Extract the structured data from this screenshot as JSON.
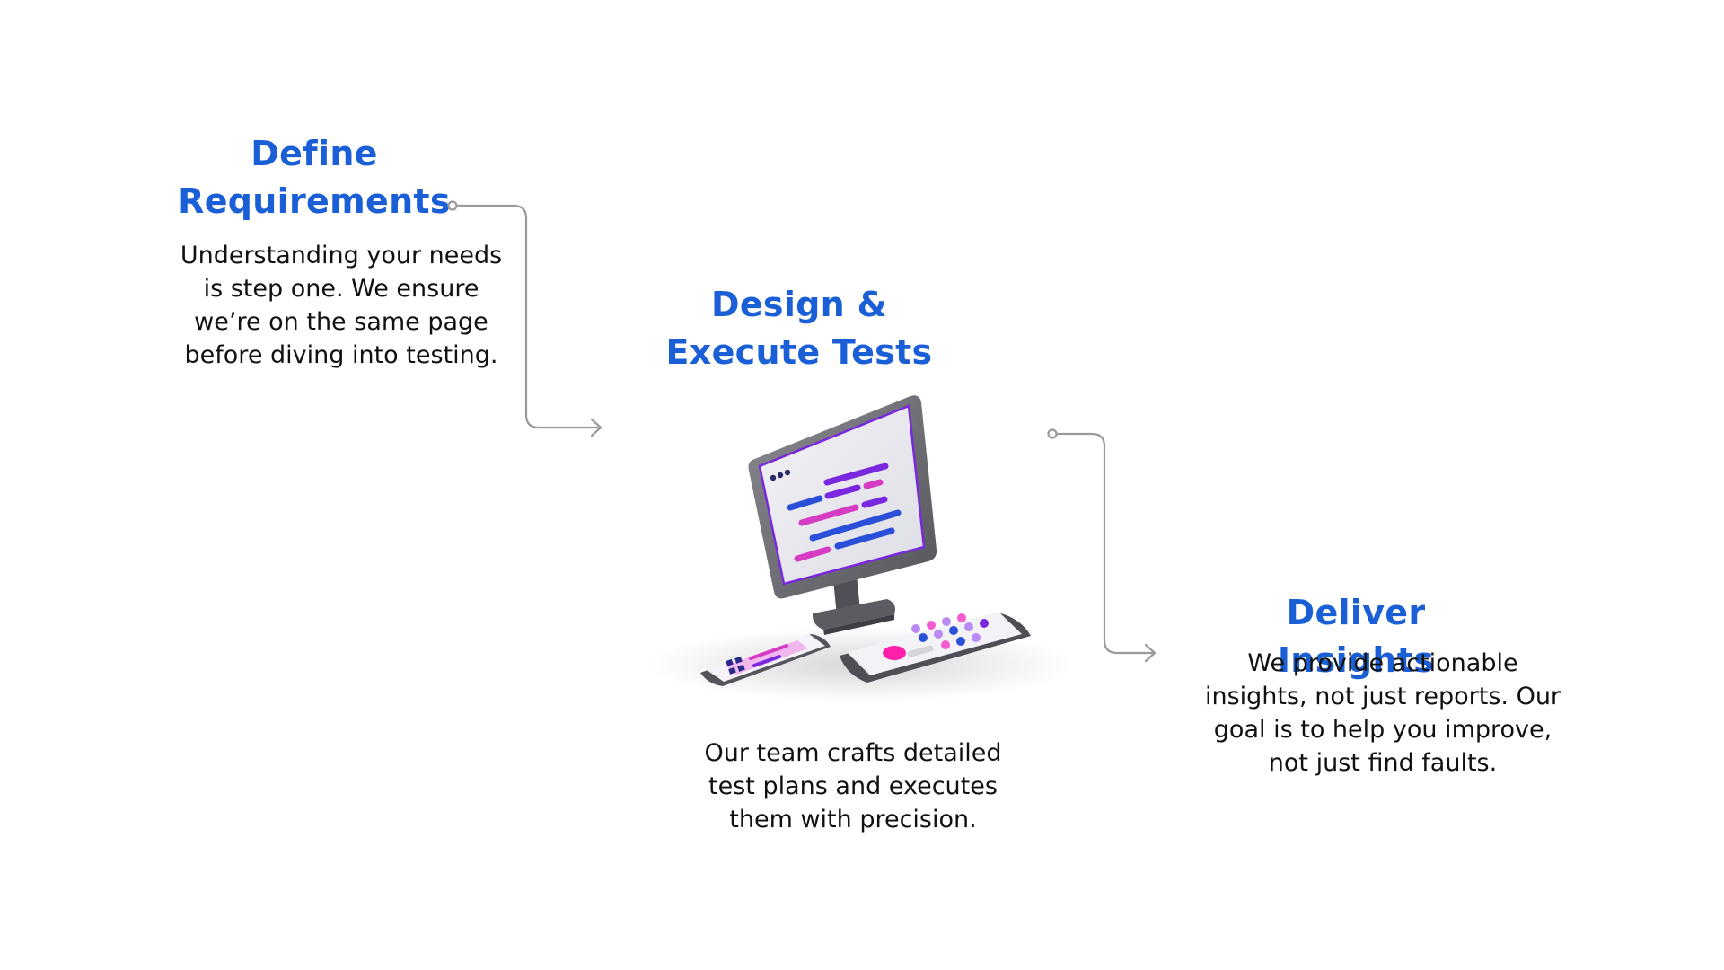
{
  "steps": [
    {
      "title": "Define Requirements",
      "description": "Understanding your needs is step one. We ensure we’re on the same page before diving into testing."
    },
    {
      "title": "Design & Execute Tests",
      "description": "Our team crafts detailed test plans and executes them with precision."
    },
    {
      "title": "Deliver Insights",
      "description": "We provide actionable insights, not just reports. Our goal is to help you improve, not just find faults."
    }
  ],
  "illustration": {
    "icon": "computer-devices-illustration",
    "colors": {
      "blue": "#2a4fd8",
      "purple": "#7a28e0",
      "magenta": "#d63bc4",
      "pink": "#f25ccf",
      "lavender": "#b98af5",
      "hot_pink": "#ff1fa8"
    }
  },
  "connector_color": "#9a9a9a",
  "heading_color": "#1a5fd6"
}
